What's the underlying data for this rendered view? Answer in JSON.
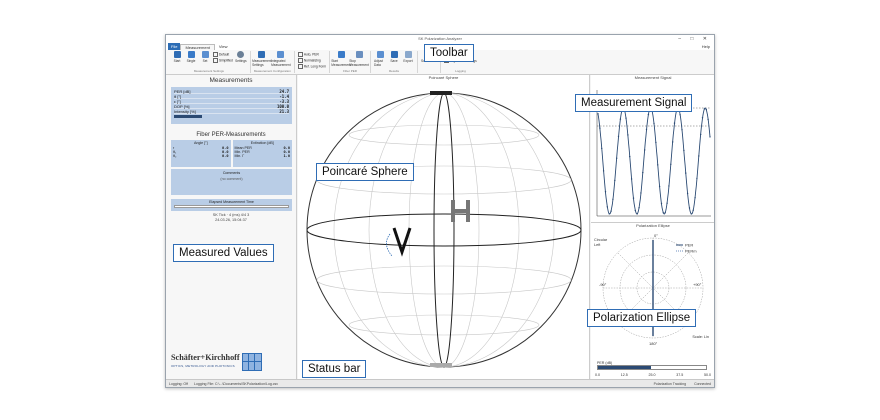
{
  "window": {
    "title": "SK Polarization Analyzer",
    "controls": "– □ ✕"
  },
  "menu": {
    "file": "File",
    "tabs": [
      "Measurement",
      "View"
    ],
    "help": "Help"
  },
  "ribbon": {
    "groups": [
      {
        "title": "Measurement Settings",
        "buttons": [
          "Start",
          "Single",
          "Set"
        ],
        "checks": [
          "Default",
          "Simplified",
          "Settings"
        ]
      },
      {
        "title": "Measurement Configuration",
        "buttons": [
          "Measurement Settings",
          "Integrated Measurement"
        ]
      },
      {
        "title": "",
        "checks": [
          "Auto, PER",
          "Normalizing",
          "Ref. Long Form"
        ]
      },
      {
        "title": "Fiber PER",
        "buttons": [
          "Start Measurement",
          "Stop Measurement"
        ]
      },
      {
        "title": "Results",
        "buttons": [
          "Adjust Data",
          "Save",
          "Export"
        ]
      },
      {
        "title": "",
        "buttons": [
          "Screenshot"
        ]
      },
      {
        "title": "Logging",
        "checks": [
          "Status",
          "Log Data"
        ],
        "buttons": [
          "Settings"
        ]
      }
    ]
  },
  "measurements": {
    "title": "Measurements",
    "rows": [
      {
        "label": "PER [dB]",
        "value": "24.7"
      },
      {
        "label": "θ [°]",
        "value": "-1.4"
      },
      {
        "label": "ε [°]",
        "value": "-3.3"
      },
      {
        "label": "DOP [%]",
        "value": "100.0"
      },
      {
        "label": "Intensity [%]",
        "value": "21.3"
      }
    ],
    "intensity_fraction": 0.213
  },
  "fiber": {
    "title": "Fiber PER-Measurements",
    "angle": {
      "header": "Angle [°]",
      "rows": [
        {
          "label": "r",
          "value": "0.0"
        },
        {
          "label": "θ₁",
          "value": "0.0"
        },
        {
          "label": "θ₂",
          "value": "0.0"
        }
      ]
    },
    "extinction": {
      "header": "Extinction [dB]",
      "rows": [
        {
          "label": "Mean PER",
          "value": "0.0"
        },
        {
          "label": "Min. PER",
          "value": "0.0"
        },
        {
          "label": "Min. Γ",
          "value": "1.0"
        }
      ]
    },
    "comments_title": "Comments",
    "comments_text": "(no comment)"
  },
  "export": {
    "title": "Elapsed Measurement Time"
  },
  "info": {
    "line1": "SK Tick · 4 (ms) 4/4 3",
    "line2": "24.03.26, 15:04:37"
  },
  "logo": {
    "name": "Schäfter+Kirchhoff",
    "tagline": "OPTICS, METROLOGY AND PHOTONICS"
  },
  "center": {
    "title": "Poincaré Sphere",
    "label_h": "H",
    "label_v": "V"
  },
  "signal": {
    "title": "Measurement Signal"
  },
  "ellipse": {
    "title": "Polarization Ellipse",
    "legend_per": "PER",
    "legend_perm": "PERm",
    "circ_label": "Circular",
    "left_label": "Left",
    "deg_top": "0°",
    "deg_left": "-90°",
    "deg_right": "+90°",
    "deg_bottom": "180°",
    "scale": "Scale: Lin",
    "per_label": "PER (dB)",
    "per_ticks": [
      "0.0",
      "12.5",
      "25.0",
      "37.5",
      "50.0"
    ],
    "per_value": 24.7,
    "per_max": 50
  },
  "status": {
    "left": "Logging: Off",
    "path": "Logging File: C:\\...\\Documents\\SKPolarization\\Log.csv",
    "mid": "Polarization Tracking",
    "right": "Connected"
  },
  "callouts": {
    "toolbar": "Toolbar",
    "signal": "Measurement Signal",
    "sphere": "Poincaré Sphere",
    "measured": "Measured Values",
    "ellipse": "Polarization Ellipse",
    "status": "Status bar"
  },
  "colors": {
    "accent": "#2f6db5",
    "panel": "#b9cde6",
    "dark_bar": "#2b4a73",
    "signal": "#2b4a73"
  }
}
